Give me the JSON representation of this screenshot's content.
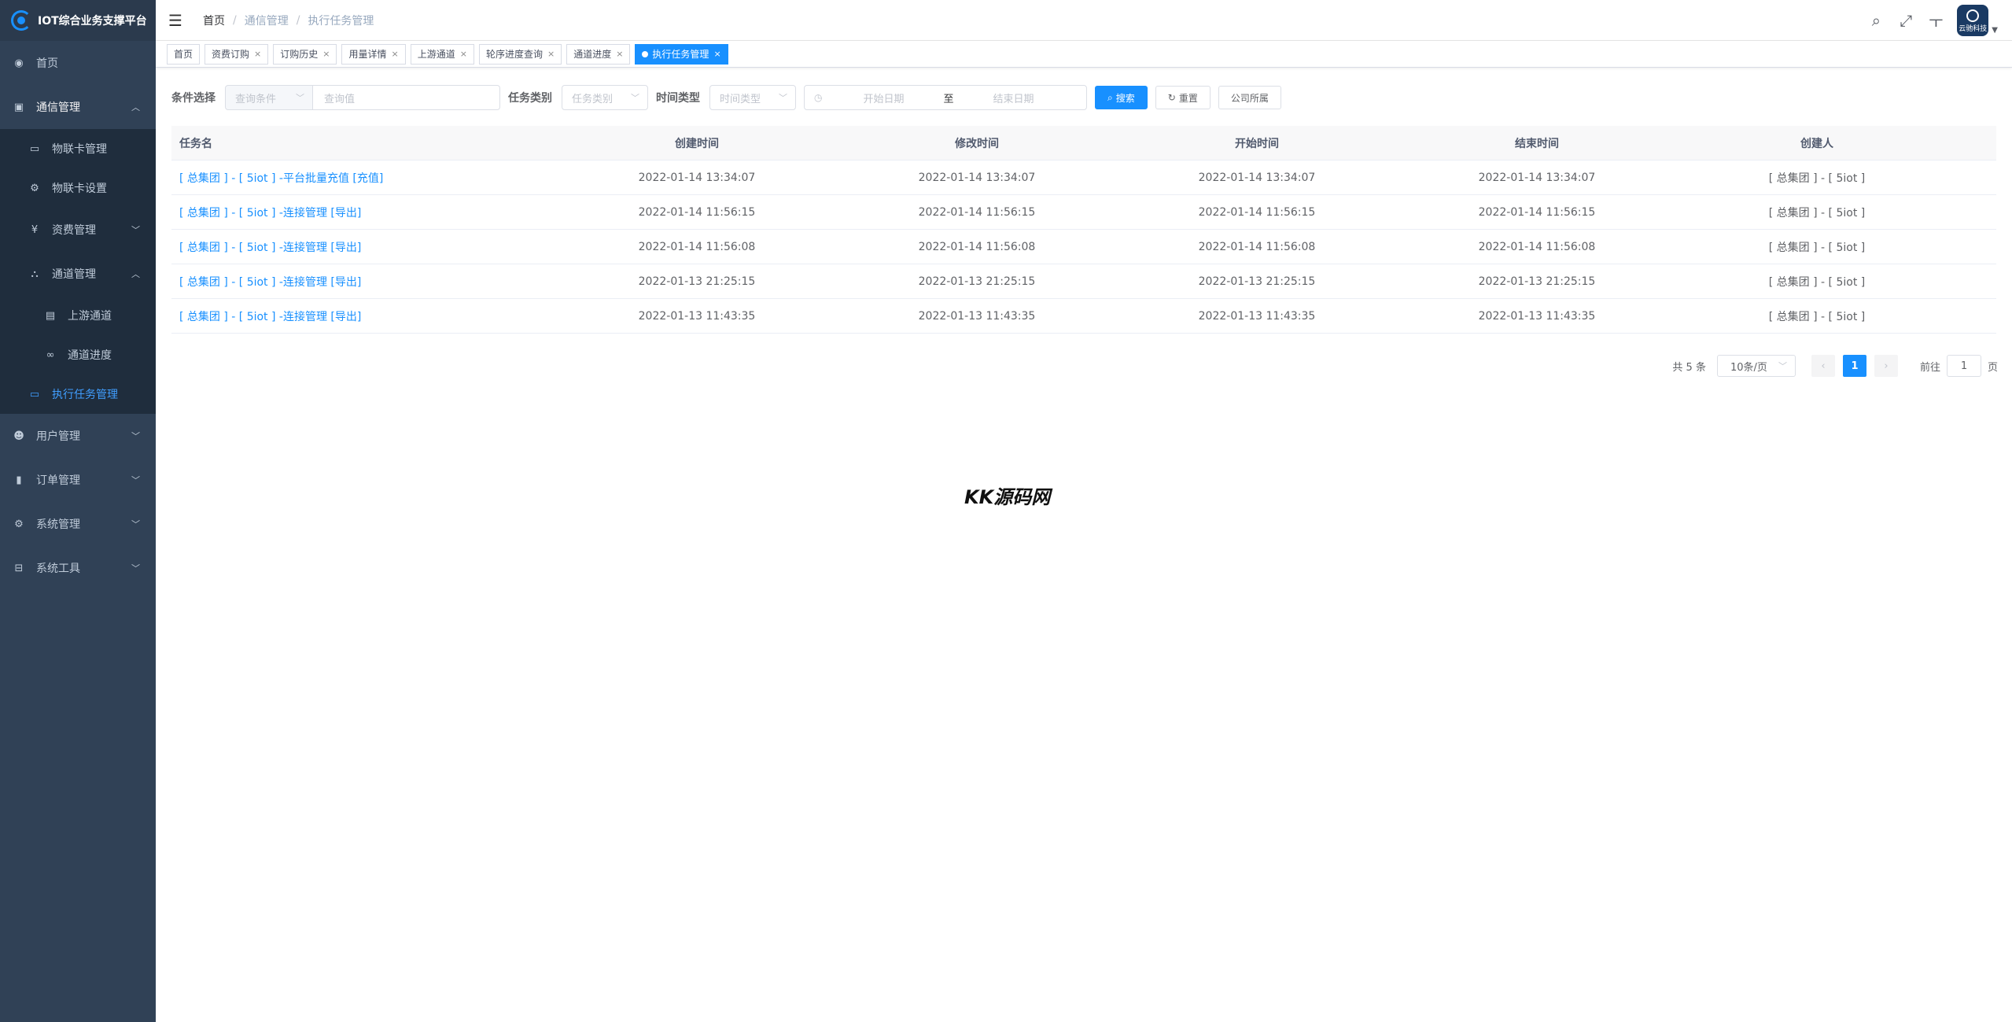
{
  "brand": {
    "title": "IOT综合业务支撑平台"
  },
  "sidebar": {
    "items": [
      {
        "label": "首页",
        "icon": "dashboard-icon"
      },
      {
        "label": "通信管理",
        "icon": "book-icon"
      },
      {
        "label": "物联卡管理",
        "icon": "card-icon"
      },
      {
        "label": "物联卡设置",
        "icon": "gear-icon"
      },
      {
        "label": "资费管理",
        "icon": "money-icon"
      },
      {
        "label": "通道管理",
        "icon": "tree-icon"
      },
      {
        "label": "上游通道",
        "icon": "document-icon"
      },
      {
        "label": "通道进度",
        "icon": "link-icon"
      },
      {
        "label": "执行任务管理",
        "icon": "monitor-icon"
      },
      {
        "label": "用户管理",
        "icon": "user-icon"
      },
      {
        "label": "订单管理",
        "icon": "chart-icon"
      },
      {
        "label": "系统管理",
        "icon": "system-icon"
      },
      {
        "label": "系统工具",
        "icon": "toolbox-icon"
      }
    ]
  },
  "header": {
    "breadcrumb": [
      "首页",
      "通信管理",
      "执行任务管理"
    ]
  },
  "tags": [
    {
      "label": "首页"
    },
    {
      "label": "资费订购"
    },
    {
      "label": "订购历史"
    },
    {
      "label": "用量详情"
    },
    {
      "label": "上游通道"
    },
    {
      "label": "轮序进度查询"
    },
    {
      "label": "通道进度"
    },
    {
      "label": "执行任务管理"
    }
  ],
  "avatar": {
    "text": "云驰科技"
  },
  "filter": {
    "cond_label": "条件选择",
    "cond_placeholder": "查询条件",
    "value_placeholder": "查询值",
    "type_label": "任务类别",
    "type_placeholder": "任务类别",
    "time_label": "时间类型",
    "time_placeholder": "时间类型",
    "start_placeholder": "开始日期",
    "range_sep": "至",
    "end_placeholder": "结束日期",
    "search_btn": "搜索",
    "reset_btn": "重置",
    "company_btn": "公司所属"
  },
  "table": {
    "headers": [
      "任务名",
      "创建时间",
      "修改时间",
      "开始时间",
      "结束时间",
      "创建人"
    ],
    "rows": [
      [
        "[ 总集团 ] - [ 5iot ] -平台批量充值 [充值]",
        "2022-01-14 13:34:07",
        "2022-01-14 13:34:07",
        "2022-01-14 13:34:07",
        "2022-01-14 13:34:07",
        "[ 总集团 ] - [ 5iot ]"
      ],
      [
        "[ 总集团 ] - [ 5iot ] -连接管理 [导出]",
        "2022-01-14 11:56:15",
        "2022-01-14 11:56:15",
        "2022-01-14 11:56:15",
        "2022-01-14 11:56:15",
        "[ 总集团 ] - [ 5iot ]"
      ],
      [
        "[ 总集团 ] - [ 5iot ] -连接管理 [导出]",
        "2022-01-14 11:56:08",
        "2022-01-14 11:56:08",
        "2022-01-14 11:56:08",
        "2022-01-14 11:56:08",
        "[ 总集团 ] - [ 5iot ]"
      ],
      [
        "[ 总集团 ] - [ 5iot ] -连接管理 [导出]",
        "2022-01-13 21:25:15",
        "2022-01-13 21:25:15",
        "2022-01-13 21:25:15",
        "2022-01-13 21:25:15",
        "[ 总集团 ] - [ 5iot ]"
      ],
      [
        "[ 总集团 ] - [ 5iot ] -连接管理 [导出]",
        "2022-01-13 11:43:35",
        "2022-01-13 11:43:35",
        "2022-01-13 11:43:35",
        "2022-01-13 11:43:35",
        "[ 总集团 ] - [ 5iot ]"
      ]
    ]
  },
  "pagination": {
    "total_text": "共 5 条",
    "page_size": "10条/页",
    "current_page": "1",
    "goto_label": "前往",
    "goto_value": "1",
    "page_suffix": "页"
  },
  "watermark": "KK源码网",
  "colors": {
    "sidebar_bg": "#304156",
    "primary": "#1890ff",
    "link": "#1890ff"
  }
}
